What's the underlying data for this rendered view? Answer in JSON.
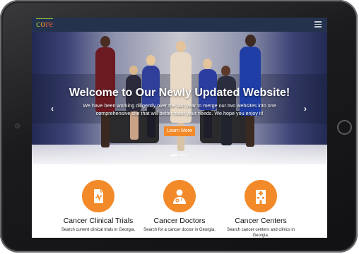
{
  "site": {
    "logo_part1": "c",
    "logo_part2": "o",
    "logo_part3": "re"
  },
  "nav": {
    "menu_icon": "hamburger-icon"
  },
  "hero": {
    "title": "Welcome to Our Newly Updated Website!",
    "subtitle": "We have been working diligently over the last year to merge our two websites into one comprehensive site that will better meet your needs. We hope you enjoy it!",
    "button_label": "Learn More",
    "prev_icon": "‹",
    "next_icon": "›",
    "slides_count": 2,
    "active_slide": 1
  },
  "services": [
    {
      "title": "Cancer Clinical Trials",
      "description": "Search current clinical trials in Georgia.",
      "icon": "clinical-document-icon"
    },
    {
      "title": "Cancer Doctors",
      "description": "Search for a cancer doctor in Georgia.",
      "icon": "doctor-icon"
    },
    {
      "title": "Cancer Centers",
      "description": "Search cancer centers and clinics in Georgia.",
      "icon": "hospital-icon"
    }
  ],
  "colors": {
    "accent": "#f28a2a",
    "navbar": "#25324d"
  }
}
